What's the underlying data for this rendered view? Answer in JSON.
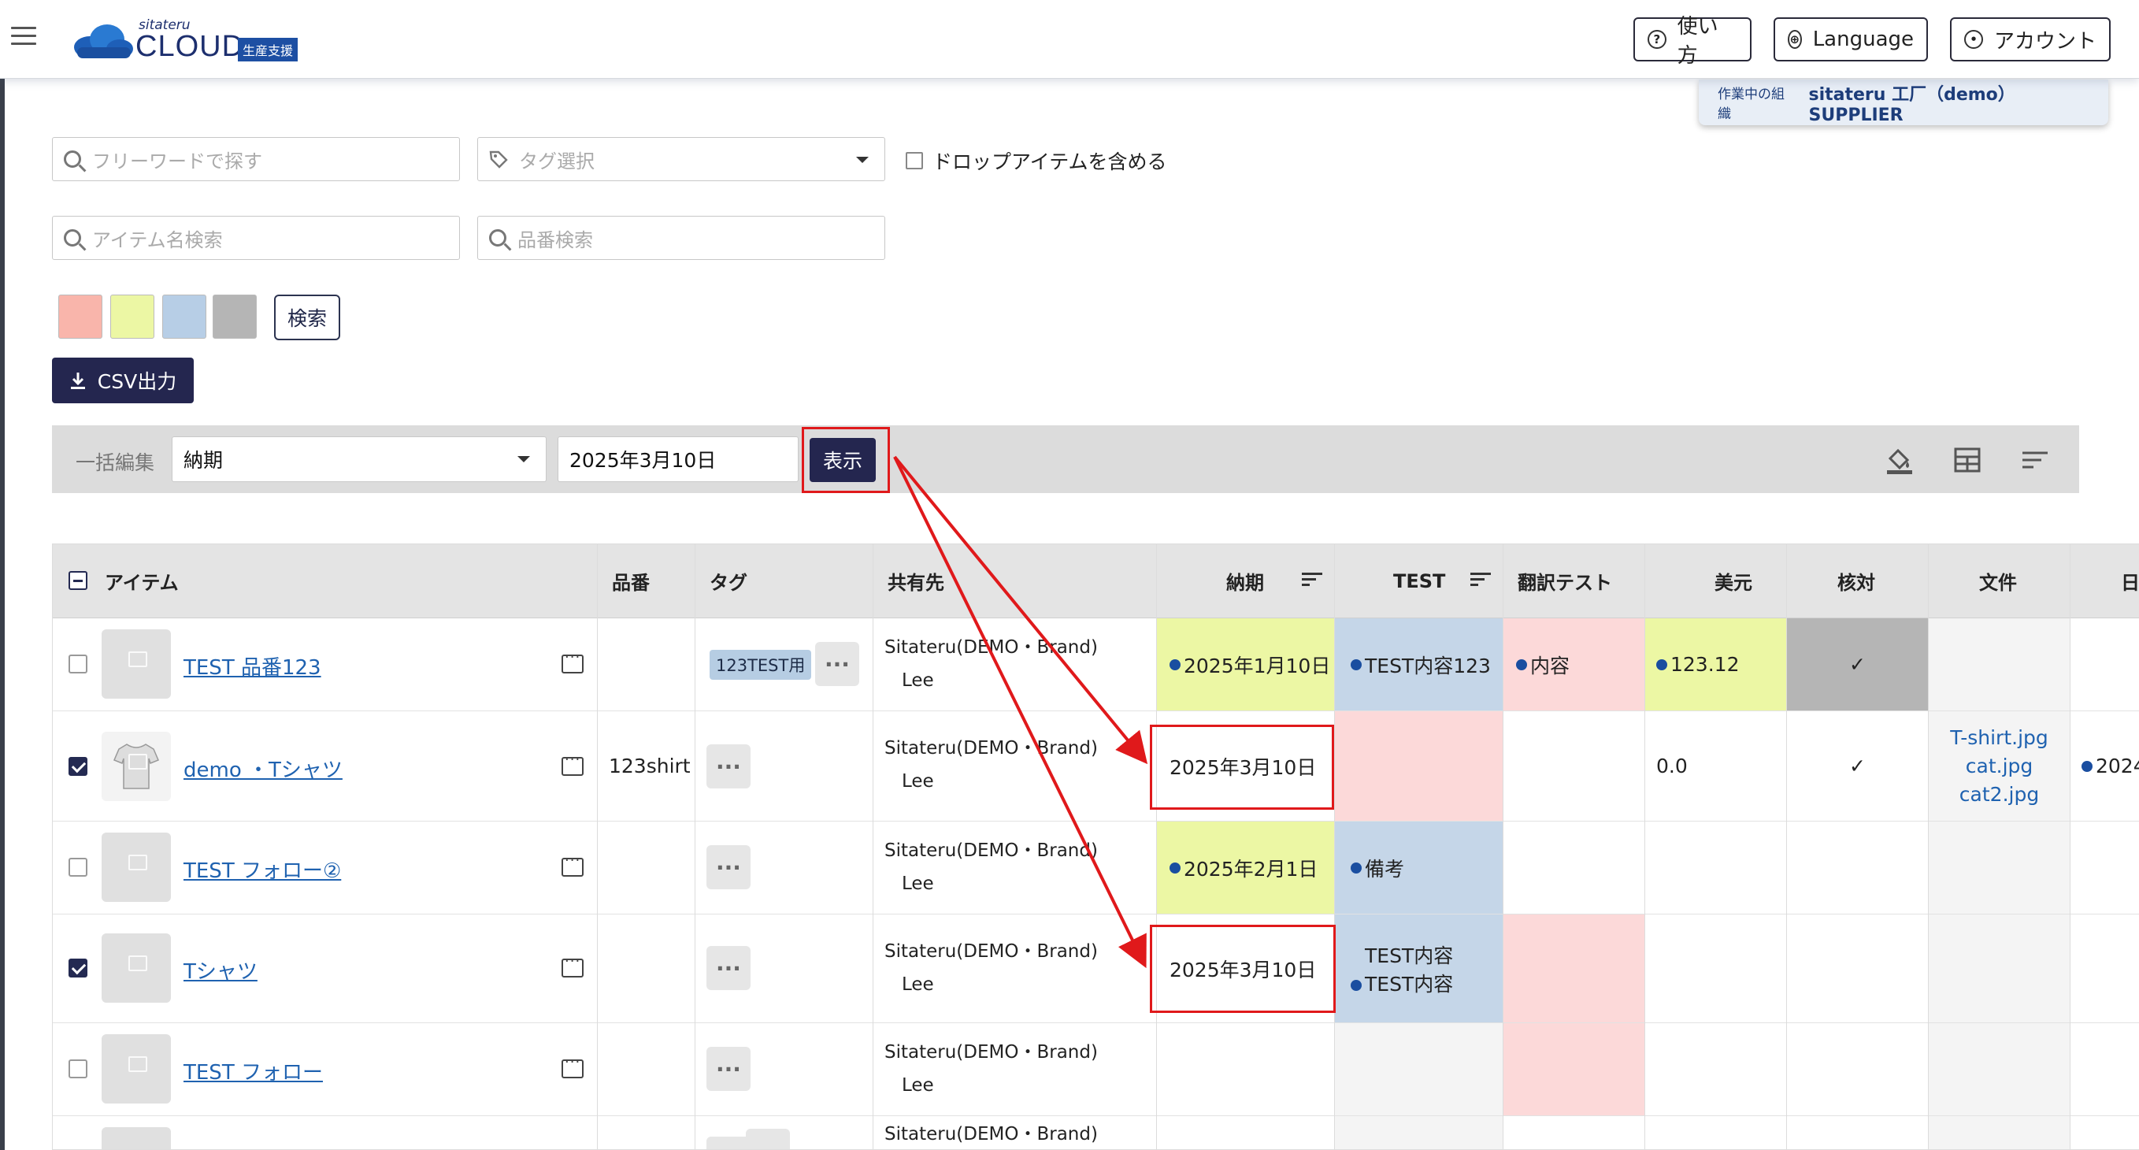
{
  "header": {
    "logo_small": "sitateru",
    "logo_main": "CLOUD",
    "logo_badge": "生産支援",
    "help_label": "使い方",
    "language_label": "Language",
    "account_label": "アカウント"
  },
  "org_bar": {
    "label": "作業中の組織",
    "org": "sitateru 工厂（demo） SUPPLIER"
  },
  "filters": {
    "freeword_placeholder": "フリーワードで探す",
    "tag_placeholder": "タグ選択",
    "include_drop_label": "ドロップアイテムを含める",
    "item_name_placeholder": "アイテム名検索",
    "part_no_placeholder": "品番検索",
    "search_label": "検索",
    "swatches": [
      "#f9b5ab",
      "#ecf7a4",
      "#b7cee6",
      "#b5b5b5"
    ],
    "csv_label": "CSV出力"
  },
  "bulk_edit": {
    "label": "一括編集",
    "field": "納期",
    "date": "2025年3月10日",
    "show_label": "表示"
  },
  "table": {
    "headers": {
      "item": "アイテム",
      "part_no": "品番",
      "tag": "タグ",
      "share": "共有先",
      "due": "納期",
      "test": "TEST",
      "trans": "翻訳テスト",
      "usd": "美元",
      "check": "核対",
      "files": "文件",
      "date": "日"
    },
    "rows": [
      {
        "name": "TEST 品番123",
        "part_no": "",
        "tag": "123TEST用",
        "share_org": "Sitateru(DEMO・Brand)",
        "share_user": "Lee",
        "due": "2025年1月10日",
        "test": "TEST内容123",
        "test2": "",
        "trans": "内容",
        "usd": "123.12",
        "check": "✓",
        "files": [],
        "date": ""
      },
      {
        "name": "demo ・Tシャツ",
        "part_no": "123shirt",
        "tag": "",
        "share_org": "Sitateru(DEMO・Brand)",
        "share_user": "Lee",
        "due": "2025年3月10日",
        "test": "",
        "test2": "",
        "trans": "",
        "usd": "0.0",
        "check": "✓",
        "files": [
          "T-shirt.jpg",
          "cat.jpg",
          "cat2.jpg"
        ],
        "date": "2024"
      },
      {
        "name": "TEST フォロー②",
        "part_no": "",
        "tag": "",
        "share_org": "Sitateru(DEMO・Brand)",
        "share_user": "Lee",
        "due": "2025年2月1日",
        "test": "備考",
        "test2": "",
        "trans": "",
        "usd": "",
        "check": "",
        "files": [],
        "date": ""
      },
      {
        "name": "Tシャツ",
        "part_no": "",
        "tag": "",
        "share_org": "Sitateru(DEMO・Brand)",
        "share_user": "Lee",
        "due": "2025年3月10日",
        "test": "TEST内容",
        "test2": "TEST内容",
        "trans": "",
        "usd": "",
        "check": "",
        "files": [],
        "date": ""
      },
      {
        "name": "TEST フォロー",
        "part_no": "",
        "tag": "",
        "share_org": "Sitateru(DEMO・Brand)",
        "share_user": "Lee",
        "due": "",
        "test": "",
        "test2": "",
        "trans": "",
        "usd": "",
        "check": "",
        "files": [],
        "date": ""
      },
      {
        "name": "",
        "part_no": "",
        "tag": "",
        "share_org": "Sitateru(DEMO・Brand)",
        "share_user": "",
        "due": "",
        "test": "",
        "test2": "",
        "trans": "",
        "usd": "",
        "check": "",
        "files": [],
        "date": ""
      }
    ]
  },
  "colors": {
    "navy": "#24264f",
    "link": "#1f62b0",
    "due_yellow": "#ecf7a4",
    "test_blue": "#c5d6e8",
    "pink": "#fcd9d9",
    "check_gray": "#b5b5b5",
    "annotation_red": "#e0191b"
  }
}
